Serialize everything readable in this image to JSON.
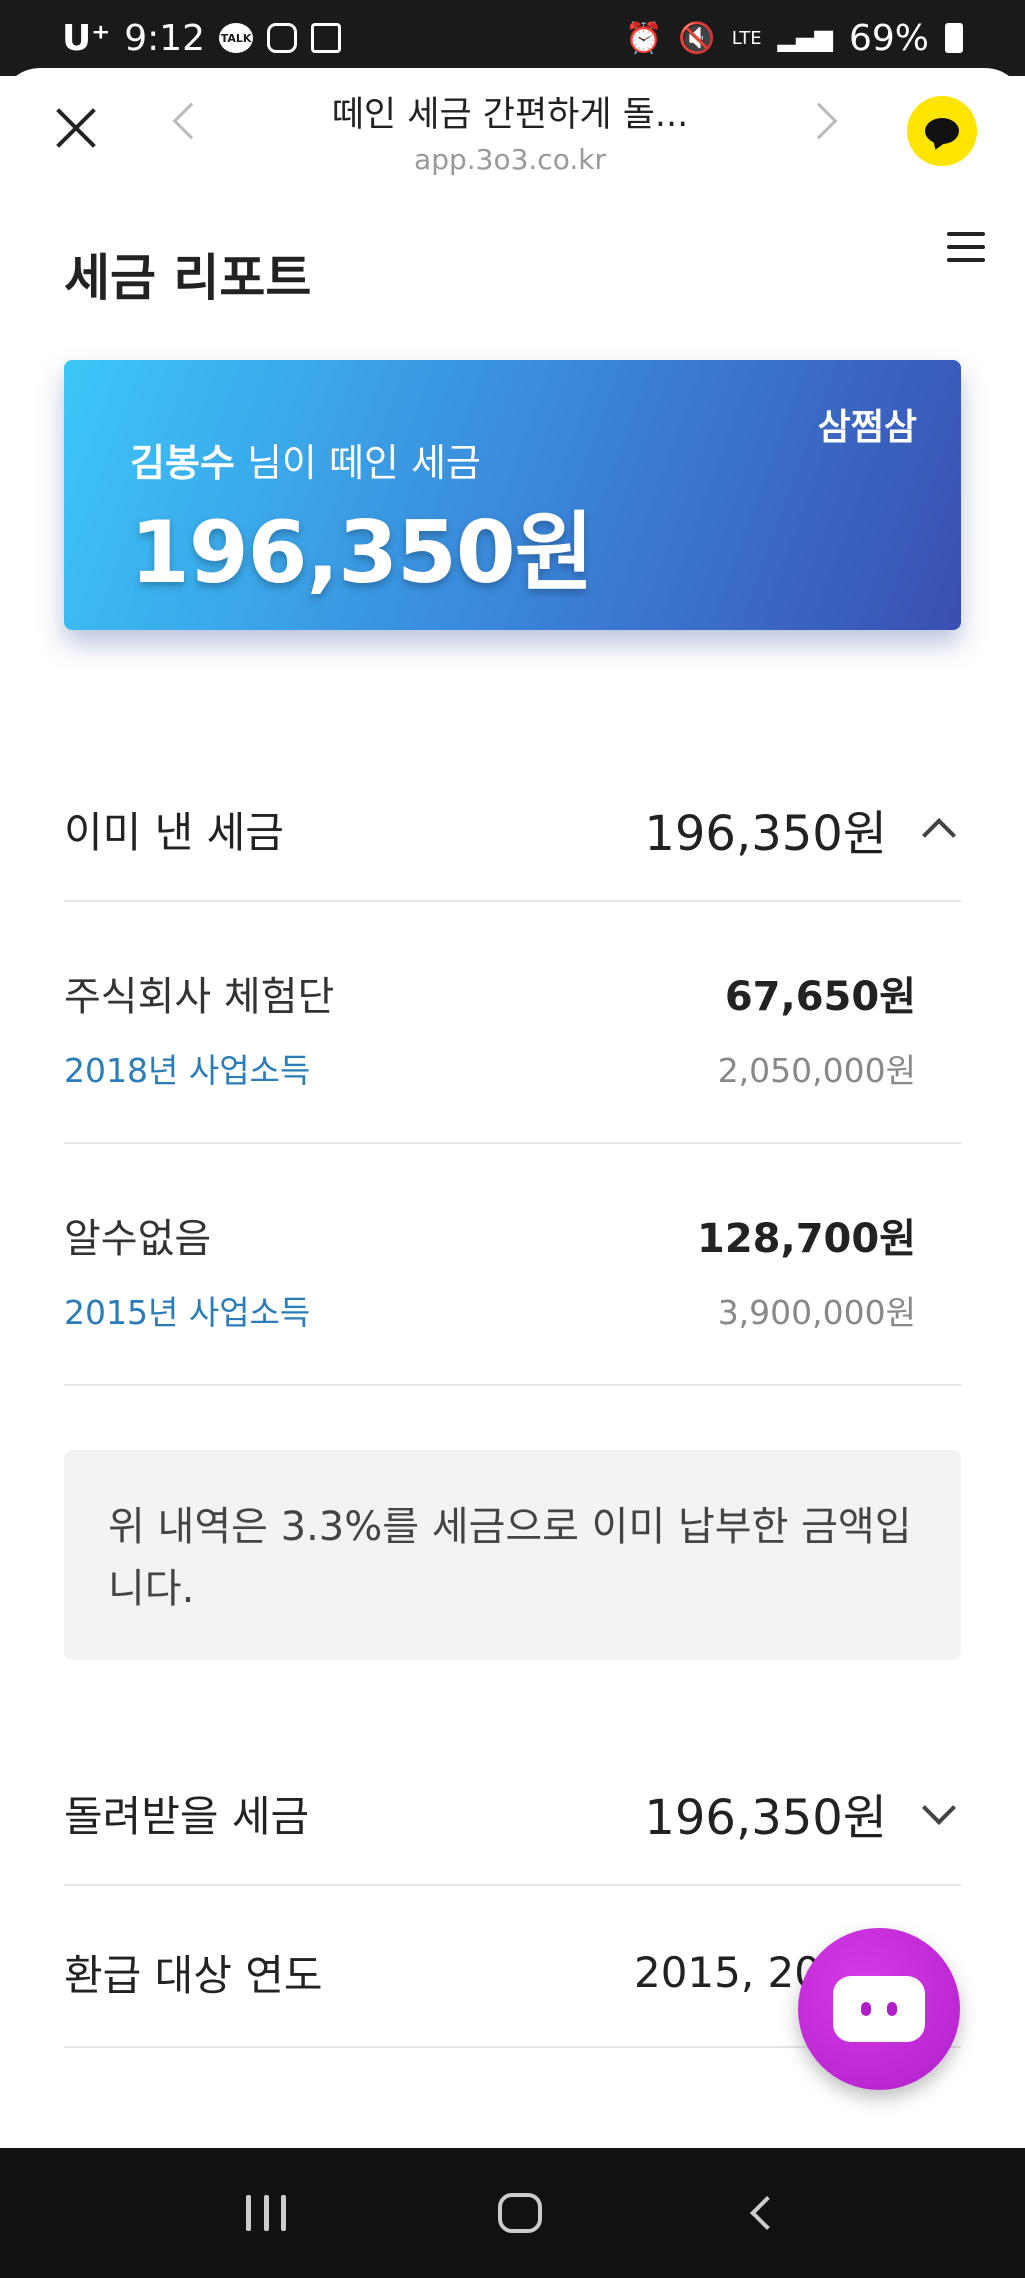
{
  "status": {
    "carrier": "U⁺",
    "time": "9:12",
    "talk_icon_text": "TALK",
    "network": "LTE",
    "battery": "69%"
  },
  "browser": {
    "page_title": "떼인 세금 간편하게 돌...",
    "url": "app.3o3.co.kr"
  },
  "page": {
    "title": "세금 리포트"
  },
  "card": {
    "brand": "삼쩜삼",
    "user_name": "김봉수",
    "line_suffix": " 님이 떼인 세금",
    "amount": "196,350원"
  },
  "paid": {
    "label": "이미 낸 세금",
    "amount": "196,350원",
    "items": [
      {
        "name": "주식회사 체험단",
        "amount": "67,650원",
        "year": "2018년 사업소득",
        "income": "2,050,000원"
      },
      {
        "name": "알수없음",
        "amount": "128,700원",
        "year": "2015년 사업소득",
        "income": "3,900,000원"
      }
    ]
  },
  "note": {
    "text": "위 내역은 3.3%를 세금으로 이미 납부한 금액입니다."
  },
  "refund": {
    "label": "돌려받을 세금",
    "amount": "196,350원"
  },
  "years": {
    "label": "환급 대상 연도",
    "value": "2015, 20"
  }
}
